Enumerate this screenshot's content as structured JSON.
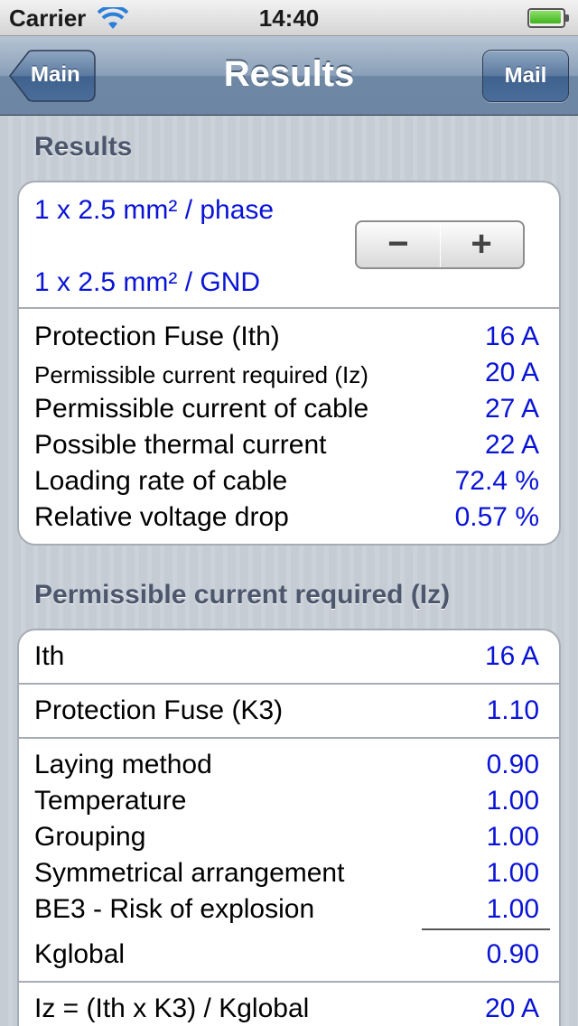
{
  "status_bar": {
    "carrier": "Carrier",
    "time": "14:40",
    "battery_level": 1.0
  },
  "nav": {
    "title": "Results",
    "back_label": "Main",
    "right_label": "Mail"
  },
  "colors": {
    "value_blue": "#0a14d6",
    "header_text": "#4c566c",
    "nav_bar": "#6d87a5"
  },
  "results_section": {
    "header": "Results",
    "cable_phase": "1 x 2.5 mm² / phase",
    "cable_gnd": "1 x 2.5 mm² / GND",
    "stepper_minus": "−",
    "stepper_plus": "+",
    "rows": [
      {
        "label": "Protection Fuse (Ith)",
        "value": "16 A"
      },
      {
        "label": "Permissible current required (Iz)",
        "value": "20 A"
      },
      {
        "label": "Permissible current of cable",
        "value": "27 A"
      },
      {
        "label": "Possible thermal current",
        "value": "22 A"
      },
      {
        "label": "Loading rate of cable",
        "value": "72.4 %"
      },
      {
        "label": "Relative voltage drop",
        "value": "0.57 %"
      }
    ]
  },
  "iz_section": {
    "header": "Permissible current required (Iz)",
    "ith": {
      "label": "Ith",
      "value": "16 A"
    },
    "k3": {
      "label": "Protection Fuse (K3)",
      "value": "1.10"
    },
    "factors": [
      {
        "label": "Laying method",
        "value": "0.90"
      },
      {
        "label": "Temperature",
        "value": "1.00"
      },
      {
        "label": "Grouping",
        "value": "1.00"
      },
      {
        "label": "Symmetrical arrangement",
        "value": "1.00"
      },
      {
        "label": "BE3 - Risk of explosion",
        "value": "1.00"
      }
    ],
    "kglobal": {
      "label": "Kglobal",
      "value": "0.90"
    },
    "formula": {
      "label": "Iz = (Ith x K3) / Kglobal",
      "value": "20 A"
    }
  }
}
